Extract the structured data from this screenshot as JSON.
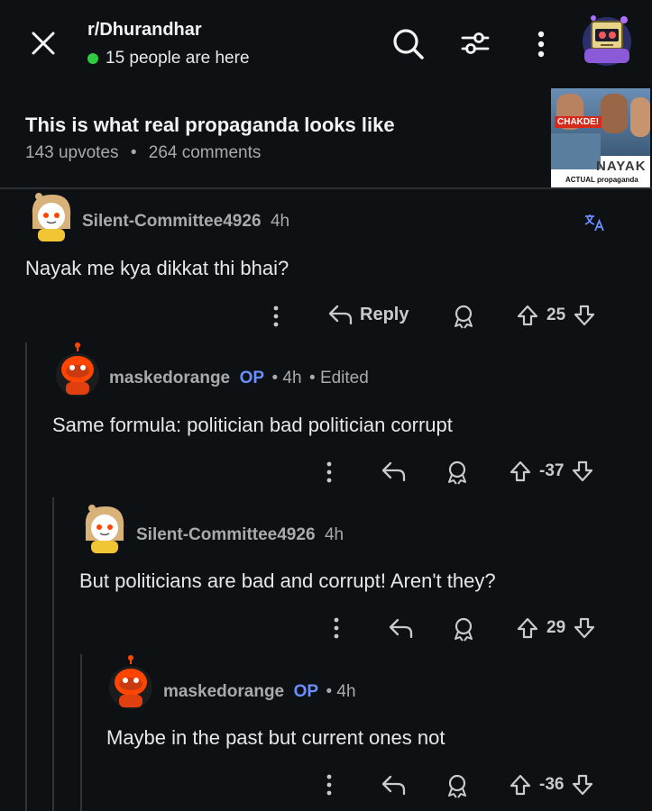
{
  "header": {
    "subreddit": "r/Dhurandhar",
    "online": "15 people are here",
    "close_icon": "close-icon",
    "search_icon": "search-icon",
    "filter_icon": "filter-icon",
    "more_icon": "more-vertical-icon",
    "avatar": "user-avatar"
  },
  "post": {
    "title": "This is what real propaganda looks like",
    "upvotes": "143 upvotes",
    "separator": "•",
    "comments": "264 comments",
    "thumbnail": {
      "badge": "CHAKDE!",
      "title": "NAYAK",
      "caption": "ACTUAL propaganda"
    }
  },
  "comments": [
    {
      "user": "Silent-Committee4926",
      "time": "4h",
      "text": "Nayak me kya dikkat thi bhai?",
      "reply_label": "Reply",
      "votes": "25",
      "translate_icon": "translate-icon"
    },
    {
      "user": "maskedorange",
      "op": "OP",
      "time": "• 4h",
      "edited": "• Edited",
      "text": "Same formula: politician bad politician corrupt",
      "votes": "-37"
    },
    {
      "user": "Silent-Committee4926",
      "time": "4h",
      "text": "But politicians are bad and corrupt! Aren't they?",
      "votes": "29"
    },
    {
      "user": "maskedorange",
      "op": "OP",
      "time": "• 4h",
      "text": "Maybe in the past but current ones not",
      "votes": "-36"
    }
  ],
  "colors": {
    "background": "#0e1113",
    "online_dot": "#2ecc40",
    "op_badge": "#6a8eff",
    "orange_avatar": "#ff4500"
  }
}
